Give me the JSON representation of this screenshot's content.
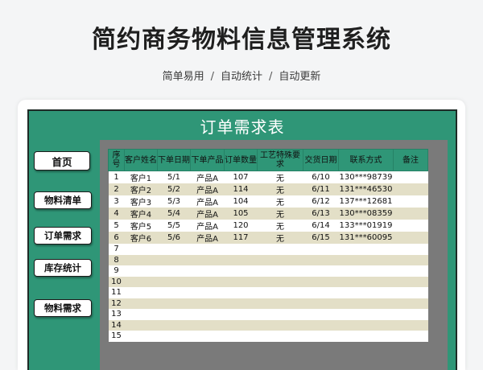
{
  "hero": {
    "title": "简约商务物料信息管理系统",
    "tags": [
      "简单易用",
      "自动统计",
      "自动更新"
    ],
    "separator": "/"
  },
  "app": {
    "title": "订单需求表",
    "colors": {
      "green": "#2f9677",
      "frame": "#7a7a7a",
      "stripe": "#e3dfc7"
    }
  },
  "nav": {
    "home": "首页",
    "materials_list": "物料清单",
    "order_demand": "订单需求",
    "inventory_stats": "库存统计",
    "material_demand": "物料需求"
  },
  "table": {
    "headers": [
      "序号",
      "客户姓名",
      "下单日期",
      "下单产品",
      "订单数量",
      "工艺特殊要求",
      "交货日期",
      "联系方式",
      "备注"
    ],
    "rows": [
      [
        "1",
        "客户1",
        "5/1",
        "产品A",
        "107",
        "无",
        "6/10",
        "130***98739",
        ""
      ],
      [
        "2",
        "客户2",
        "5/2",
        "产品A",
        "114",
        "无",
        "6/11",
        "131***46530",
        ""
      ],
      [
        "3",
        "客户3",
        "5/3",
        "产品A",
        "104",
        "无",
        "6/12",
        "137***12681",
        ""
      ],
      [
        "4",
        "客户4",
        "5/4",
        "产品A",
        "105",
        "无",
        "6/13",
        "130***08359",
        ""
      ],
      [
        "5",
        "客户5",
        "5/5",
        "产品A",
        "120",
        "无",
        "6/14",
        "133***01919",
        ""
      ],
      [
        "6",
        "客户6",
        "5/6",
        "产品A",
        "117",
        "无",
        "6/15",
        "131***60095",
        ""
      ],
      [
        "7",
        "",
        "",
        "",
        "",
        "",
        "",
        "",
        ""
      ],
      [
        "8",
        "",
        "",
        "",
        "",
        "",
        "",
        "",
        ""
      ],
      [
        "9",
        "",
        "",
        "",
        "",
        "",
        "",
        "",
        ""
      ],
      [
        "10",
        "",
        "",
        "",
        "",
        "",
        "",
        "",
        ""
      ],
      [
        "11",
        "",
        "",
        "",
        "",
        "",
        "",
        "",
        ""
      ],
      [
        "12",
        "",
        "",
        "",
        "",
        "",
        "",
        "",
        ""
      ],
      [
        "13",
        "",
        "",
        "",
        "",
        "",
        "",
        "",
        ""
      ],
      [
        "14",
        "",
        "",
        "",
        "",
        "",
        "",
        "",
        ""
      ],
      [
        "15",
        "",
        "",
        "",
        "",
        "",
        "",
        "",
        ""
      ]
    ]
  }
}
